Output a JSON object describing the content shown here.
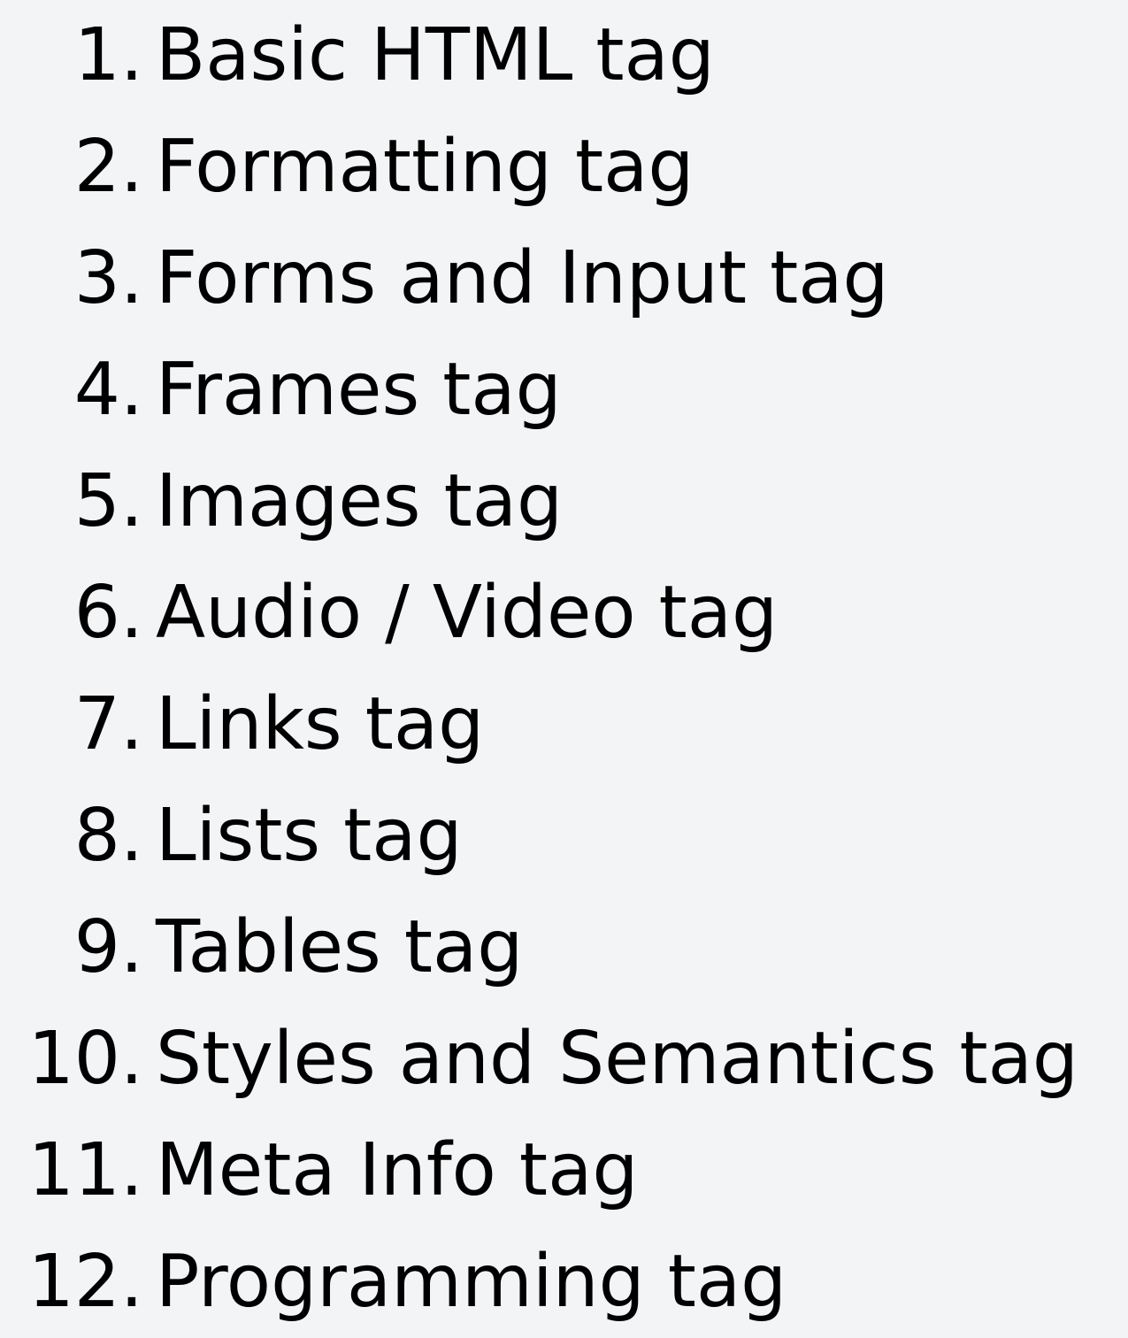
{
  "list": {
    "items": [
      {
        "number": "1.",
        "label": "Basic HTML tag"
      },
      {
        "number": "2.",
        "label": "Formatting tag"
      },
      {
        "number": "3.",
        "label": "Forms and Input tag"
      },
      {
        "number": "4.",
        "label": "Frames tag"
      },
      {
        "number": "5.",
        "label": "Images tag"
      },
      {
        "number": "6.",
        "label": "Audio / Video tag"
      },
      {
        "number": "7.",
        "label": "Links tag"
      },
      {
        "number": "8.",
        "label": "Lists tag"
      },
      {
        "number": "9.",
        "label": "Tables tag"
      },
      {
        "number": "10.",
        "label": "Styles and Semantics tag"
      },
      {
        "number": "11.",
        "label": "Meta Info tag"
      },
      {
        "number": "12.",
        "label": "Programming tag"
      }
    ]
  },
  "colors": {
    "background": "#f3f4f6",
    "text": "#000000"
  }
}
